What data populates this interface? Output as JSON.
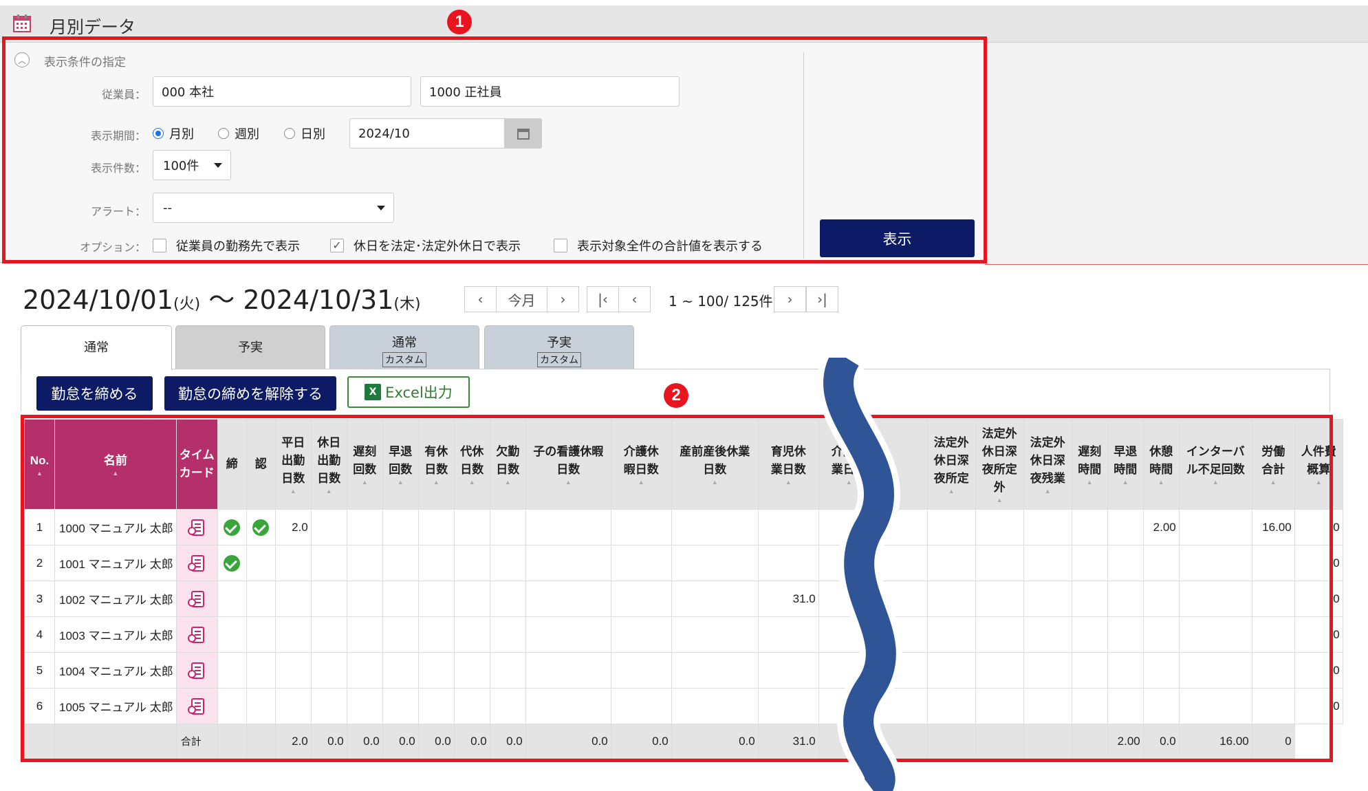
{
  "header": {
    "title": "月別データ",
    "icon": "calendar-icon"
  },
  "conditions": {
    "toggle_label": "表示条件の指定",
    "employee_label": "従業員：",
    "employee_value1": "000 本社",
    "employee_value2": "1000 正社員",
    "period_label": "表示期間：",
    "period_options": [
      "月別",
      "週別",
      "日別"
    ],
    "period_selected": "月別",
    "period_date": "2024/10",
    "count_label": "表示件数：",
    "count_value": "100件",
    "alert_label": "アラート：",
    "alert_value": "--",
    "option_label": "オプション：",
    "options": [
      {
        "label": "従業員の勤務先で表示",
        "checked": false
      },
      {
        "label": "休日を法定･法定外休日で表示",
        "checked": true
      },
      {
        "label": "表示対象全件の合計値を表示する",
        "checked": false
      }
    ],
    "show_button": "表示"
  },
  "markers": {
    "one": "1",
    "two": "2"
  },
  "range": {
    "start": "2024/10/01",
    "start_dow": "(火)",
    "sep": " 〜 ",
    "end": "2024/10/31",
    "end_dow": "(木)"
  },
  "pager": {
    "this_month": "今月",
    "info": "1 ~ 100/ 125件"
  },
  "tabs": [
    {
      "label": "通常",
      "sub": ""
    },
    {
      "label": "予実",
      "sub": ""
    },
    {
      "label": "通常",
      "sub": "カスタム"
    },
    {
      "label": "予実",
      "sub": "カスタム"
    }
  ],
  "actions": {
    "close": "勤怠を締める",
    "unclose": "勤怠の締めを解除する",
    "excel": "Excel出力"
  },
  "table": {
    "headers": [
      "No.",
      "名前",
      "タイムカード",
      "締",
      "認",
      "平日出勤日数",
      "休日出勤日数",
      "遅刻回数",
      "早退回数",
      "有休日数",
      "代休日数",
      "欠勤日数",
      "子の看護休暇日数",
      "介護休暇日数",
      "産前産後休業日数",
      "育児休業日数",
      "介護休業日数",
      "",
      "法定外休日深夜所定",
      "法定外休日深夜所定外",
      "法定外休日深夜残業",
      "遅刻時間",
      "早退時間",
      "休憩時間",
      "インターバル不足回数",
      "労働合計",
      "人件費概算"
    ],
    "rows": [
      {
        "no": "1",
        "name": "1000 マニュアル 太郎",
        "shime": true,
        "nin": true,
        "heijitsu": "2.0",
        "ikuji": "",
        "kyukei": "2.00",
        "roudou": "16.00",
        "jinken": "0"
      },
      {
        "no": "2",
        "name": "1001 マニュアル 太郎",
        "shime": true,
        "nin": false,
        "heijitsu": "",
        "ikuji": "",
        "kyukei": "",
        "roudou": "",
        "jinken": "0"
      },
      {
        "no": "3",
        "name": "1002 マニュアル 太郎",
        "shime": false,
        "nin": false,
        "heijitsu": "",
        "ikuji": "31.0",
        "kyukei": "",
        "roudou": "",
        "jinken": "0"
      },
      {
        "no": "4",
        "name": "1003 マニュアル 太郎",
        "shime": false,
        "nin": false,
        "heijitsu": "",
        "ikuji": "",
        "kyukei": "",
        "roudou": "",
        "jinken": "0"
      },
      {
        "no": "5",
        "name": "1004 マニュアル 太郎",
        "shime": false,
        "nin": false,
        "heijitsu": "",
        "ikuji": "",
        "kyukei": "",
        "roudou": "",
        "jinken": "0"
      },
      {
        "no": "6",
        "name": "1005 マニュアル 太郎",
        "shime": false,
        "nin": false,
        "heijitsu": "",
        "ikuji": "",
        "kyukei": "",
        "roudou": "",
        "jinken": "0"
      }
    ],
    "total": {
      "label": "合計",
      "heijitsu": "2.0",
      "kyujitsu": "0.0",
      "chikoku": "0.0",
      "soutai": "0.0",
      "yukyu": "0.0",
      "daikyu": "0.0",
      "kekkin": "0.0",
      "kango": "0.0",
      "kaigokyuka": "0.0",
      "sanzen": "0.0",
      "ikuji": "31.0",
      "kyukei": "2.00",
      "interval": "0.0",
      "roudou": "16.00",
      "jinken": "0"
    }
  }
}
